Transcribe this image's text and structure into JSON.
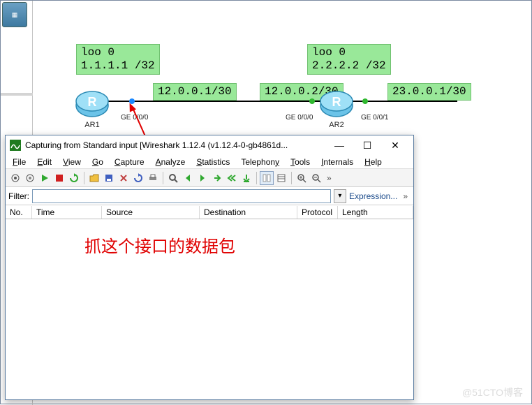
{
  "topology": {
    "ar1": {
      "label": "AR1",
      "loopback": "loo 0\n1.1.1.1 /32",
      "ge0_ip": "12.0.0.1/30",
      "ge0_name": "GE 0/0/0"
    },
    "ar2": {
      "label": "AR2",
      "loopback": "loo 0\n2.2.2.2 /32",
      "ge0_ip": "12.0.0.2/30",
      "ge0_name": "GE 0/0/0",
      "ge1_ip": "23.0.0.1/30",
      "ge1_name": "GE 0/0/1"
    }
  },
  "annotation_text": "抓这个接口的数据包",
  "wireshark": {
    "title": "Capturing from Standard input   [Wireshark 1.12.4  (v1.12.4-0-gb4861d...",
    "menus": [
      "File",
      "Edit",
      "View",
      "Go",
      "Capture",
      "Analyze",
      "Statistics",
      "Telephony",
      "Tools",
      "Internals",
      "Help"
    ],
    "filter_label": "Filter:",
    "filter_value": "",
    "expression_link": "Expression...",
    "columns": [
      "No.",
      "Time",
      "Source",
      "Destination",
      "Protocol",
      "Length"
    ]
  },
  "watermark": "@51CTO博客"
}
